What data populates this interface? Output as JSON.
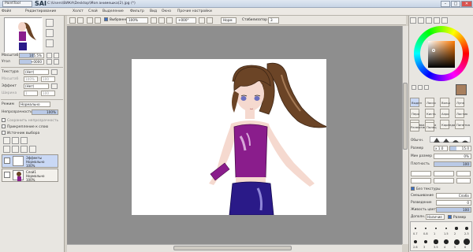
{
  "app": {
    "logo_text": "PaintTool",
    "name": "SAI",
    "path": "C:\\Users\\ВИКА\\Desktop\\Моя анимешка(2).jpg (*)"
  },
  "window_controls": {
    "minimize": "–",
    "maximize": "□",
    "close": "✕"
  },
  "menu": [
    "Файл",
    "Редактирование",
    "Холст",
    "Слой",
    "Выделение",
    "Фильтр",
    "Вид",
    "Окно",
    "Прочие настройки"
  ],
  "toolbar": {
    "selection_checkbox_label": "Выбранное",
    "zoom": "100%",
    "angle": "+000°",
    "flip_label": "Норм",
    "stabilizer_label": "Стабилизатор",
    "stabilizer_value": "3"
  },
  "navigator": {
    "zoom_label": "Масштаб",
    "zoom_value": "105.5%",
    "angle_label": "Угол",
    "angle_value": "+0000"
  },
  "texture": {
    "label": "Текстура",
    "value": "(Нет)",
    "scale_label": "Масштаб",
    "scale_value": "100%",
    "strength_label": "Интенсивность",
    "strength_value": "100",
    "effect_label": "Эффект",
    "effect_value": "(Нет)",
    "width_label": "Ширина",
    "width_value": "1",
    "intensity2_label": "Интенсивность",
    "intensity2_value": "100"
  },
  "layer_props": {
    "mode_label": "Режим",
    "mode_value": "Нормально",
    "opacity_label": "Непрозрачность",
    "opacity_value": "100%",
    "opacity_pct": 100,
    "preserve_opacity": "Сохранить непрозрачность",
    "clipping_group": "Прикрепление к слою",
    "selection_source": "Источник выбора"
  },
  "layers": [
    {
      "name": "Эффекты",
      "mode": "Нормально",
      "opacity": "100%",
      "selected": true
    },
    {
      "name": "Слой1",
      "mode": "Нормально",
      "opacity": "100%",
      "selected": false
    }
  ],
  "tools": {
    "row1": [
      "Выдел",
      "Лассо",
      "Волш",
      "Лупа"
    ],
    "row2": [
      "Перо",
      "Кисть",
      "Аэро",
      "Ластик"
    ],
    "row3": [
      "Заливка",
      "Ведро",
      "Карандаш",
      "Пипетка"
    ],
    "row4": [
      "Размытие",
      "Палец"
    ]
  },
  "brush_settings": {
    "mode_label": "Обычн.",
    "size_label": "Размер",
    "size_multiplier": "x 1.0",
    "size_value": "15.0",
    "min_size_label": "Мин размер",
    "min_size_value": "0%",
    "density_label": "Плотность",
    "density_value": "100",
    "edge_label": "Без текстуры",
    "blending_label": "Смешивание",
    "blending_value": "Слабо",
    "dilution_label": "Разведение",
    "dilution_value": "0",
    "persistence_label": "Живость цвета",
    "persistence_value": "100",
    "detail_label": "Дополн.",
    "detail_value": "Наличие",
    "keep_opacity": "Размер"
  },
  "brush_sizes": [
    "0.7",
    "0.8",
    "1",
    "1.5",
    "2",
    "2.3",
    "2.6",
    "3",
    "3.5",
    "4",
    "5",
    "6"
  ],
  "colors": {
    "canvas_bg": "#8e8e8e",
    "current_color": "#a77f5e",
    "selected_layer": "#c9d8f5"
  }
}
